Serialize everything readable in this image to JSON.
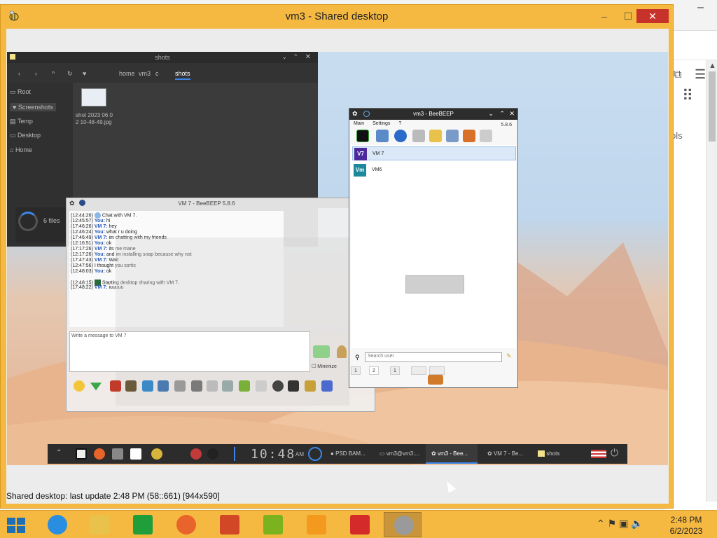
{
  "main_window": {
    "title": "vm3 - Shared desktop",
    "status": "Shared desktop: last update 2:48 PM (58::661) [944x590]",
    "minimize": "–",
    "maximize": "☐",
    "close": "✕"
  },
  "file_manager": {
    "title": "shots",
    "crumbs": [
      "home",
      "vm3",
      "c",
      "shots"
    ],
    "sidebar": [
      "Root",
      "Screenshots",
      "Temp",
      "Desktop",
      "Home"
    ],
    "file_name": "shot 2023 06 0 2 10-48-49.jpg",
    "progress_text": "6 files"
  },
  "chat_window": {
    "title": "VM 7 - BeeBEEP 5.8.6",
    "messages": [
      {
        "time": "(12:44:26)",
        "who": "",
        "text": "Chat with VM 7."
      },
      {
        "time": "(12:45:57)",
        "who": "You:",
        "text": "hi"
      },
      {
        "time": "(17:46:26)",
        "who": "VM 7:",
        "text": "hey"
      },
      {
        "time": "(12:46:24)",
        "who": "You:",
        "text": "what r u doing"
      },
      {
        "time": "(17:46:49)",
        "who": "VM 7:",
        "text": "im chatting with my friends"
      },
      {
        "time": "(12:16:51)",
        "who": "You:",
        "text": "ok"
      },
      {
        "time": "(17:17:26)",
        "who": "VM 7:",
        "text": "its me mane"
      },
      {
        "time": "(12:17:26)",
        "who": "You:",
        "text": "and im installing snap because why not"
      },
      {
        "time": "(17:47:43)",
        "who": "VM 7:",
        "text": "Wait"
      },
      {
        "time": "(12:47:56)",
        "who": "",
        "text": "I thought you sortic"
      },
      {
        "time": "(12:48:03)",
        "who": "You:",
        "text": "ok"
      },
      {
        "time": "(12:48:15)",
        "who": "",
        "text": "Starting desktop sharing with VM 7."
      },
      {
        "time": "(17:48:22)",
        "who": "VM 7:",
        "text": "iuuuuu"
      }
    ],
    "input_placeholder": "Write a message to VM 7",
    "minimize_label": "Minimize"
  },
  "beebeep": {
    "title": "vm3 - BeeBEEP",
    "menu": [
      "Main",
      "Settings",
      "?"
    ],
    "version": "5.8.6",
    "users": [
      {
        "avatar": "V7",
        "name": "VM 7",
        "color": "#4b2a9e"
      },
      {
        "avatar": "Vm",
        "name": "VM6",
        "color": "#1c8a9c"
      }
    ],
    "search_placeholder": "Search user",
    "tabs": [
      "1",
      "2",
      "1",
      "",
      ""
    ]
  },
  "remote_taskbar": {
    "clock": "10:48",
    "clock_ampm": "AM",
    "windows": [
      "PSD BAM...",
      "vm3@vm3:...",
      "vm3 - Bee...",
      "VM 7 - Be...",
      "shots"
    ]
  },
  "taskbar": {
    "time": "2:48 PM",
    "date": "6/2/2023",
    "apps": [
      {
        "name": "internet-explorer",
        "color": "#2a8ee0"
      },
      {
        "name": "file-explorer",
        "color": "#e8c24a"
      },
      {
        "name": "store",
        "color": "#1f9e3a"
      },
      {
        "name": "firefox",
        "color": "#e8642a"
      },
      {
        "name": "powerpoint",
        "color": "#d24726"
      },
      {
        "name": "publisher",
        "color": "#7ab31e"
      },
      {
        "name": "slides",
        "color": "#f39a1e"
      },
      {
        "name": "text-editor",
        "color": "#d42a2a"
      },
      {
        "name": "beebeep",
        "color": "#9a9a9a"
      }
    ]
  }
}
